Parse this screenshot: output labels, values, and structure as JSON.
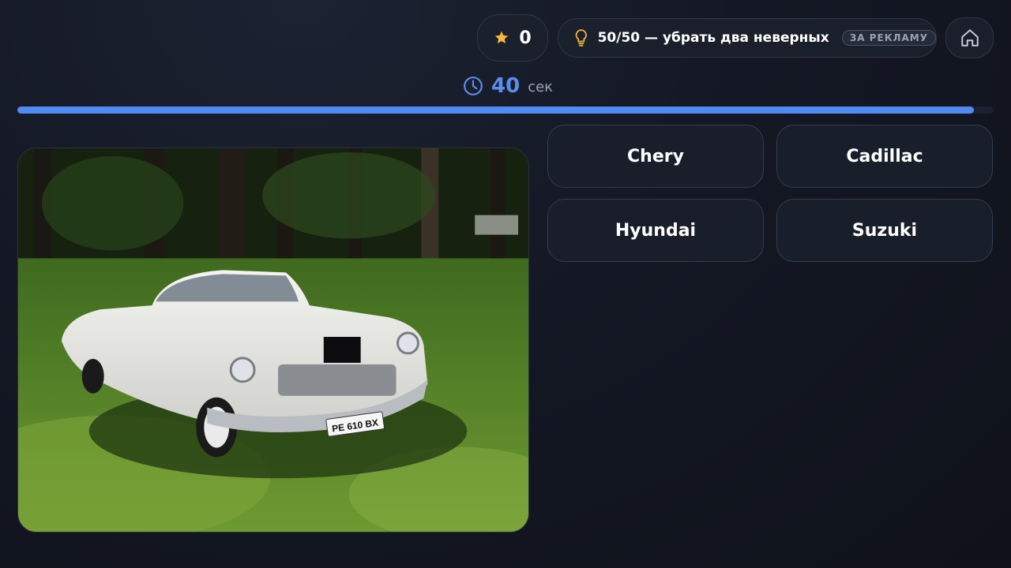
{
  "score": {
    "value": "0",
    "icon": "star-icon"
  },
  "hint": {
    "label": "50/50 — убрать два неверных",
    "badge": "ЗА РЕКЛАМУ",
    "icon": "lightbulb-icon"
  },
  "home": {
    "icon": "home-icon"
  },
  "timer": {
    "value": "40",
    "unit": "сек",
    "progress": 0.98
  },
  "photo": {
    "plate": "PE 610 BX"
  },
  "answers": [
    "Chery",
    "Cadillac",
    "Hyundai",
    "Suzuki"
  ],
  "colors": {
    "accent": "#4f8bf0",
    "star": "#f5b83d",
    "background": "#141824"
  }
}
